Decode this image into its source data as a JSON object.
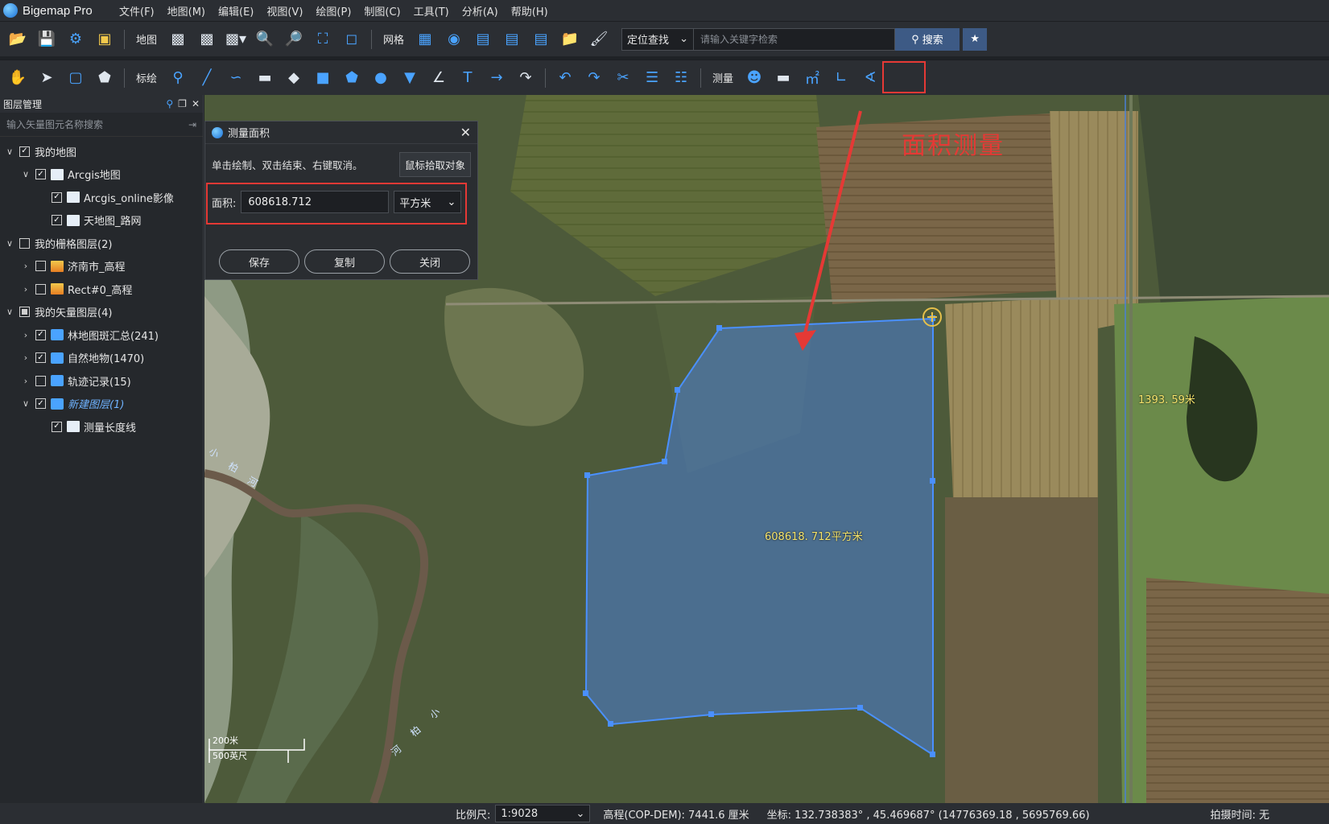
{
  "app": {
    "title": "Bigemap Pro"
  },
  "menu": [
    "文件(F)",
    "地图(M)",
    "编辑(E)",
    "视图(V)",
    "绘图(P)",
    "制图(C)",
    "工具(T)",
    "分析(A)",
    "帮助(H)"
  ],
  "toolbar1": {
    "map_label": "地图",
    "grid_label": "网格",
    "search_type": "定位查找",
    "search_placeholder": "请输入关键字检索",
    "search_button": "搜索"
  },
  "toolbar2": {
    "annotate_label": "标绘",
    "measure_label": "测量"
  },
  "layers_panel": {
    "title": "图层管理",
    "search_placeholder": "输入矢量图元名称搜索",
    "items": [
      {
        "label": "我的地图",
        "level": 0,
        "checked": true,
        "expand": "open"
      },
      {
        "label": "Arcgis地图",
        "level": 1,
        "checked": true,
        "expand": "open"
      },
      {
        "label": "Arcgis_online影像",
        "level": 2,
        "checked": true,
        "expand": "none"
      },
      {
        "label": "天地图_路网",
        "level": 2,
        "checked": true,
        "expand": "none"
      },
      {
        "label": "我的栅格图层(2)",
        "level": 0,
        "checked": false,
        "expand": "open"
      },
      {
        "label": "济南市_高程",
        "level": 1,
        "checked": false,
        "expand": "closed"
      },
      {
        "label": "Rect#0_高程",
        "level": 1,
        "checked": false,
        "expand": "closed"
      },
      {
        "label": "我的矢量图层(4)",
        "level": 0,
        "checked": "partial",
        "expand": "open"
      },
      {
        "label": "林地图斑汇总(241)",
        "level": 1,
        "checked": true,
        "expand": "closed"
      },
      {
        "label": "自然地物(1470)",
        "level": 1,
        "checked": true,
        "expand": "closed"
      },
      {
        "label": "轨迹记录(15)",
        "level": 1,
        "checked": false,
        "expand": "closed"
      },
      {
        "label": "新建图层(1)",
        "level": 1,
        "checked": true,
        "expand": "open"
      },
      {
        "label": "测量长度线",
        "level": 2,
        "checked": true,
        "expand": "none"
      }
    ]
  },
  "dialog": {
    "title": "测量面积",
    "hint": "单击绘制、双击结束、右键取消。",
    "pick_button": "鼠标拾取对象",
    "area_label": "面积:",
    "area_value": "608618.712",
    "unit": "平方米",
    "buttons": [
      "保存",
      "复制",
      "关闭"
    ]
  },
  "map": {
    "annotation_text": "面积测量",
    "polygon_label": "608618. 712平方米",
    "line_label": "1393. 59米",
    "scale_metric": "200米",
    "scale_imperial": "500英尺",
    "river_labels": [
      "小",
      "柏",
      "河",
      "小",
      "柏",
      "河"
    ],
    "accent_color": "#e53935",
    "polygon_color": "#4a7fd6"
  },
  "status": {
    "scale_label": "比例尺:",
    "scale_value": "1:9028",
    "elevation": "高程(COP-DEM):  7441.6 厘米",
    "coords": "坐标:  132.738383° , 45.469687°  (14776369.18 , 5695769.66)",
    "capture_time": "拍摄时间:  无"
  }
}
